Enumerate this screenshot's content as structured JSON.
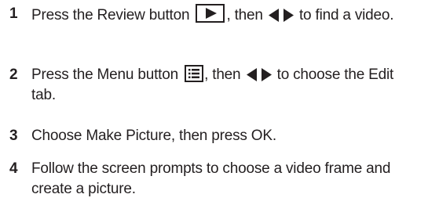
{
  "steps": [
    {
      "number": "1",
      "part_a": "Press the Review button",
      "part_b": ", then",
      "part_c": "to find a video.",
      "icons": [
        "review-button-icon",
        "left-right-arrows-icon"
      ]
    },
    {
      "number": "2",
      "part_a": "Press the Menu button",
      "part_b": ", then",
      "part_c": "to choose the Edit tab.",
      "icons": [
        "menu-button-icon",
        "left-right-arrows-icon"
      ]
    },
    {
      "number": "3",
      "text": "Choose Make Picture, then press OK."
    },
    {
      "number": "4",
      "text": "Follow the screen prompts to choose a video frame and create a picture."
    }
  ],
  "colors": {
    "text": "#231f20"
  }
}
